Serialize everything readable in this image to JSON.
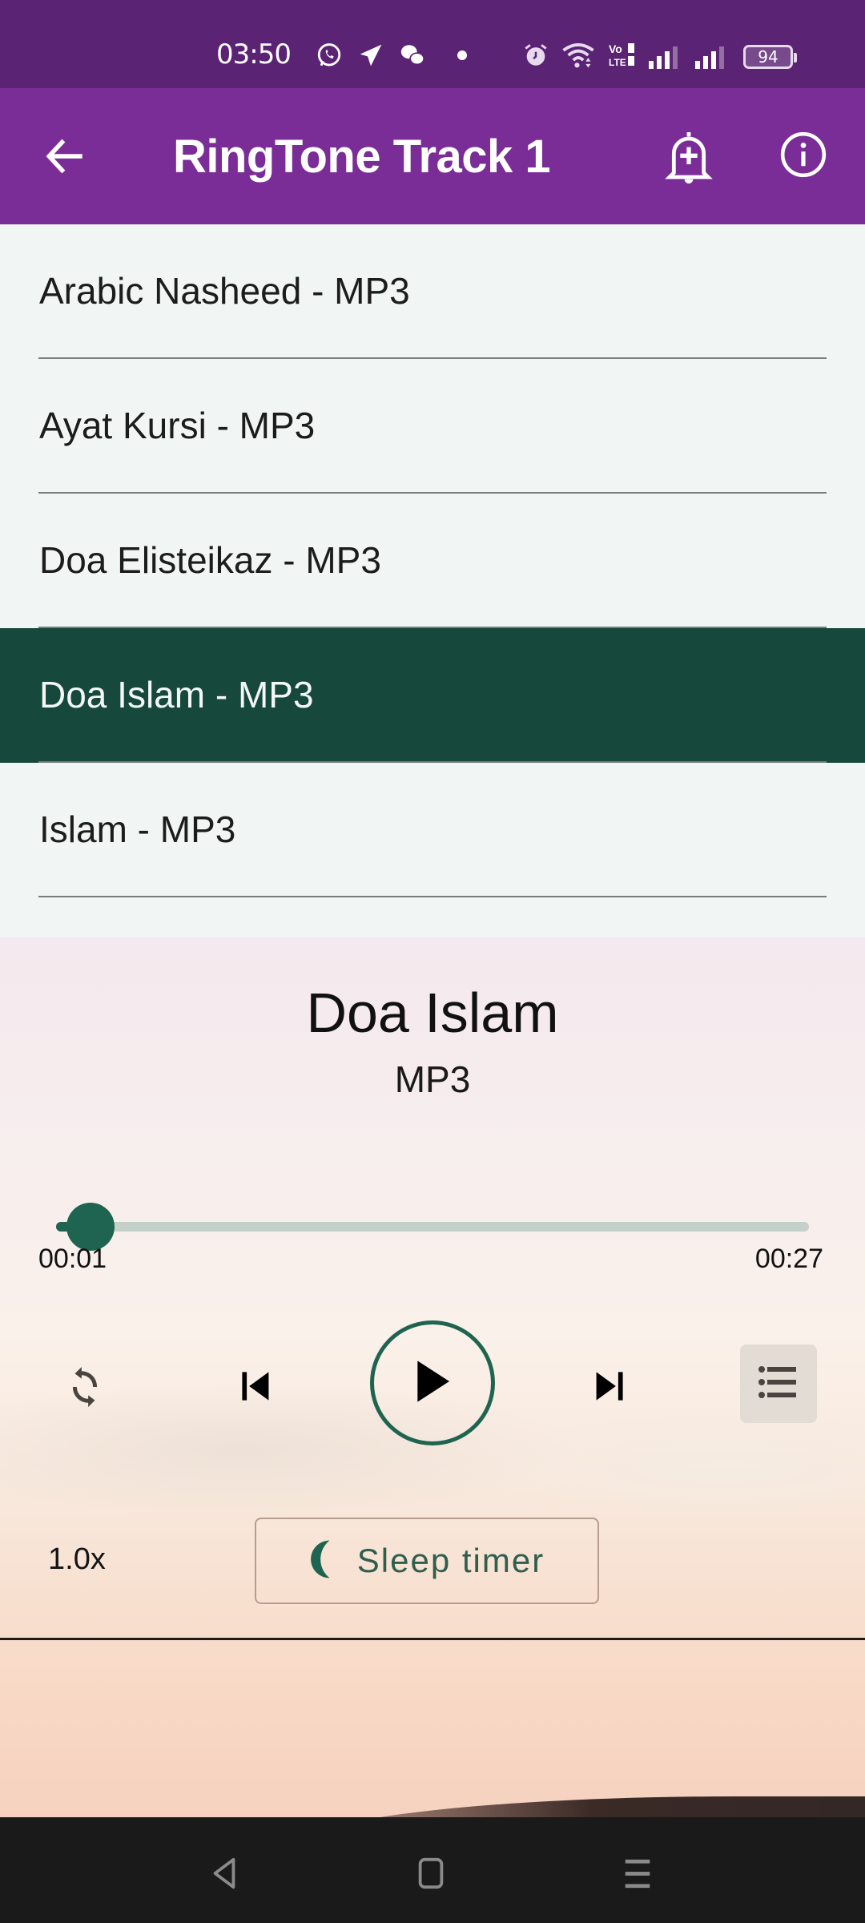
{
  "status_bar": {
    "time": "03:50",
    "notification_icons": [
      "whatsapp-icon",
      "telegram-icon",
      "wechat-icon",
      "dot-icon"
    ],
    "system_icons": [
      "alarm-icon",
      "wifi-icon",
      "volte-icon",
      "signal-sim1-icon",
      "signal-sim2-icon"
    ],
    "battery_level": "94"
  },
  "app_bar": {
    "title": "RingTone Track 1",
    "back_icon": "arrow-back-icon",
    "actions": [
      "bell-add-icon",
      "info-icon"
    ]
  },
  "tracks": [
    {
      "label": "Arabic Nasheed - MP3",
      "active": false
    },
    {
      "label": "Ayat Kursi - MP3",
      "active": false
    },
    {
      "label": "Doa Elisteikaz - MP3",
      "active": false
    },
    {
      "label": "Doa Islam - MP3",
      "active": true
    },
    {
      "label": "Islam - MP3",
      "active": false
    }
  ],
  "player": {
    "title": "Doa Islam",
    "format": "MP3",
    "current_time": "00:01",
    "total_time": "00:27",
    "progress_fraction": 0.037,
    "controls": [
      "repeat-icon",
      "skip-previous-icon",
      "play-icon",
      "skip-next-icon",
      "playlist-icon"
    ],
    "speed": "1.0x",
    "sleep_timer_label": "Sleep timer"
  },
  "colors": {
    "status_bar": "#5a2373",
    "app_bar": "#7b2d97",
    "active_row": "#17483c",
    "accent": "#1f6450"
  },
  "nav_bar": [
    "back-nav-icon",
    "home-nav-icon",
    "recents-nav-icon"
  ]
}
